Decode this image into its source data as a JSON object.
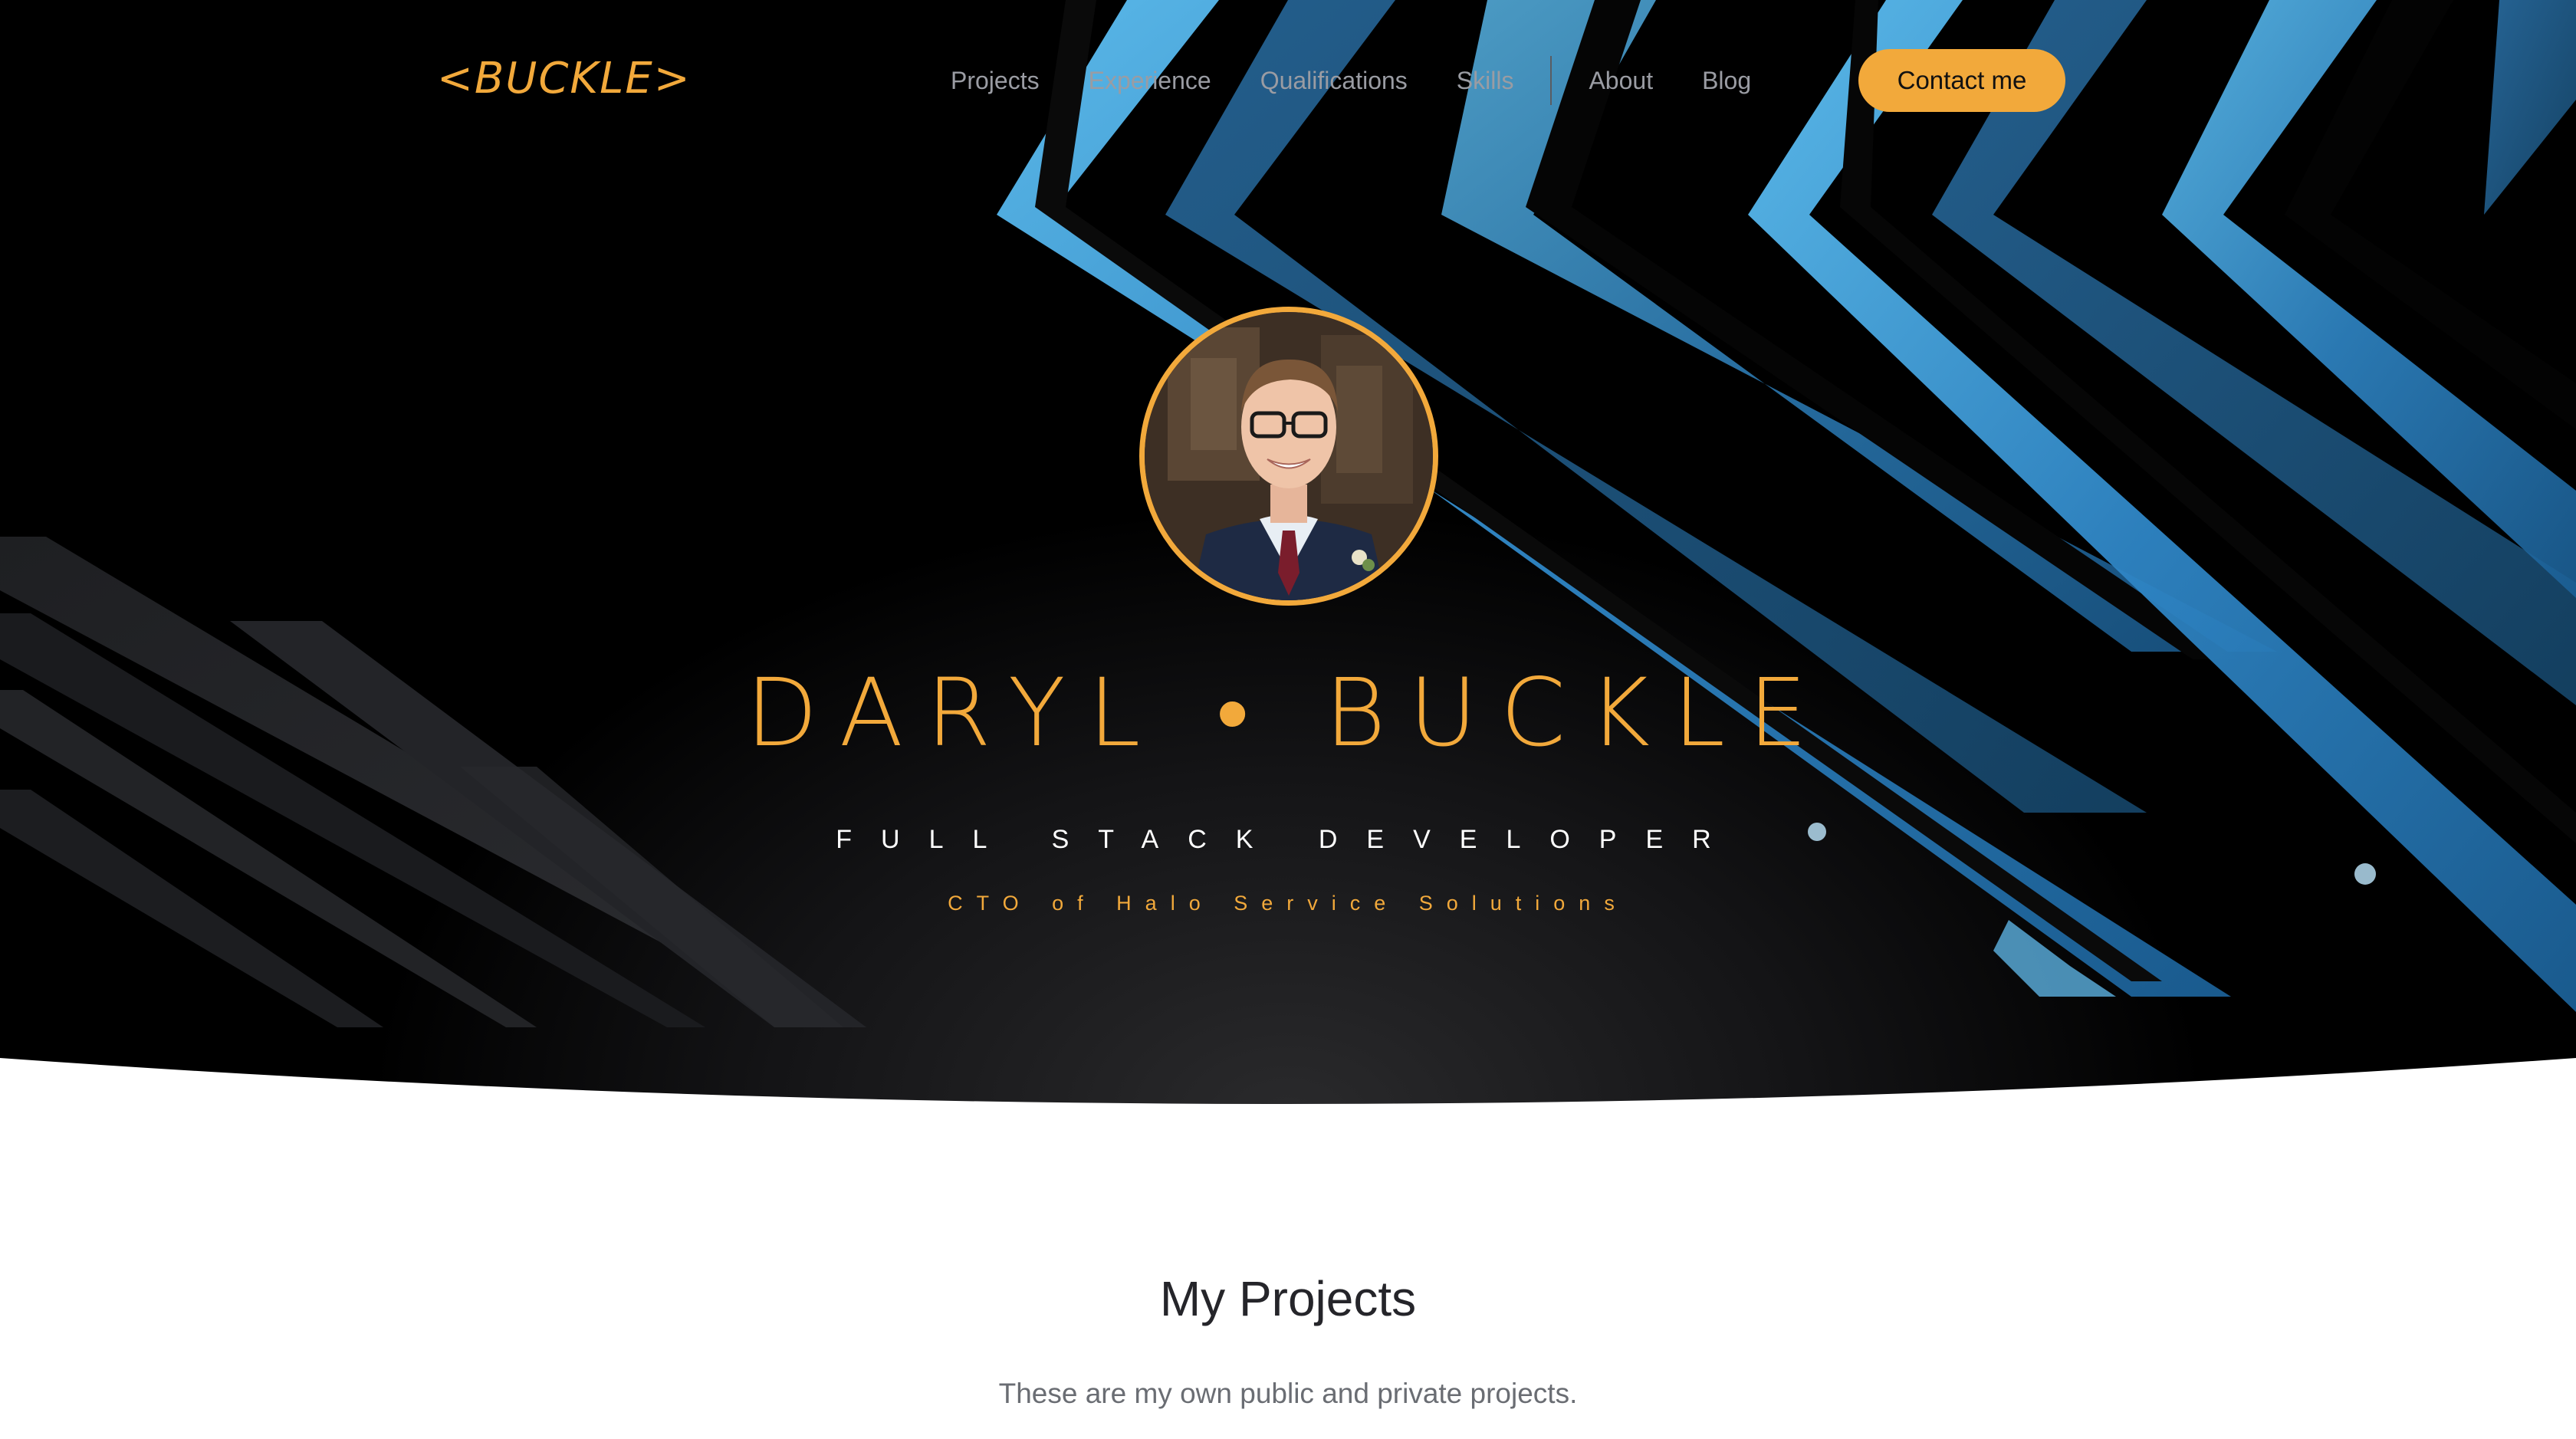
{
  "header": {
    "logo_text": "<BUCKLE>",
    "nav": [
      {
        "label": "Projects"
      },
      {
        "label": "Experience"
      },
      {
        "label": "Qualifications"
      },
      {
        "label": "Skills"
      },
      {
        "label": "About"
      },
      {
        "label": "Blog"
      }
    ],
    "contact_label": "Contact me"
  },
  "hero": {
    "name": "DARYL • BUCKLE",
    "role": "FULL STACK DEVELOPER",
    "subtitle": "CTO of Halo Service Solutions"
  },
  "projects": {
    "title": "My Projects",
    "description": "These are my own public and private projects."
  },
  "colors": {
    "accent": "#f2a93b",
    "hero_bg": "#000000",
    "stripe_blue": "#3a9ddd",
    "nav_text": "#9a9ca3"
  },
  "icons": {
    "avatar": "profile-photo"
  }
}
